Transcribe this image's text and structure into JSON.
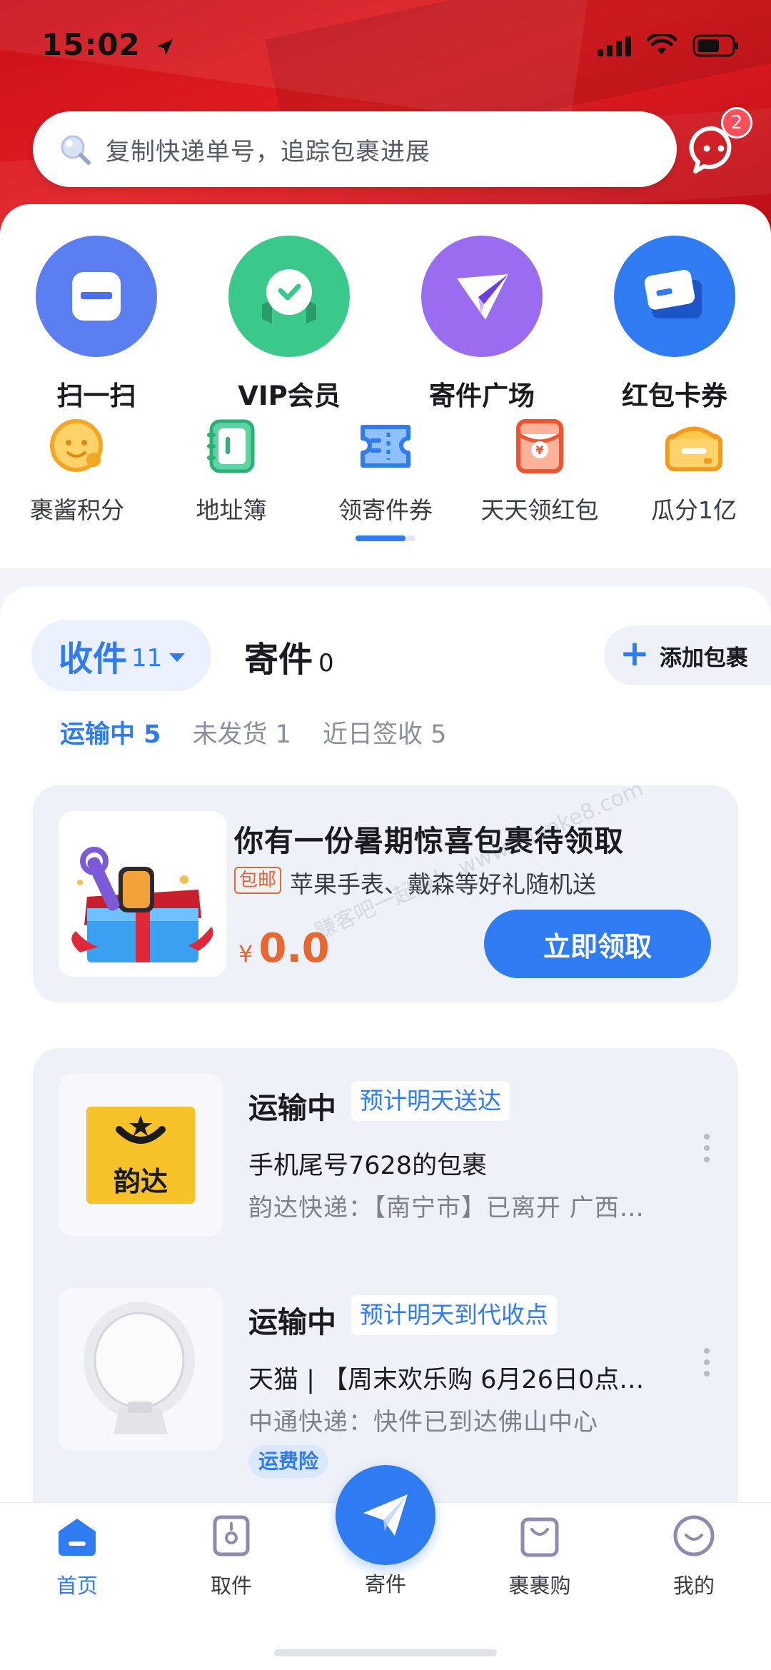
{
  "status_bar": {
    "time": "15:02"
  },
  "search": {
    "placeholder": "复制快递单号，追踪包裹进展",
    "message_badge": "2"
  },
  "main_grid": [
    {
      "label": "扫一扫",
      "icon": "scan-icon",
      "color": "#5b7ff0"
    },
    {
      "label": "VIP会员",
      "icon": "vip-icon",
      "color": "#3bc98b"
    },
    {
      "label": "寄件广场",
      "icon": "send-square-icon",
      "color": "#9a6cf0"
    },
    {
      "label": "红包卡券",
      "icon": "coupon-wallet-icon",
      "color": "#2f7bf1"
    }
  ],
  "sub_grid": [
    {
      "label": "裹酱积分",
      "icon": "points-icon"
    },
    {
      "label": "地址簿",
      "icon": "address-book-icon"
    },
    {
      "label": "领寄件券",
      "icon": "ticket-icon"
    },
    {
      "label": "天天领红包",
      "icon": "red-envelope-icon"
    },
    {
      "label": "瓜分1亿",
      "icon": "treasure-box-icon"
    }
  ],
  "parcel_tabs": {
    "receive_label": "收件",
    "receive_count": "11",
    "send_label": "寄件",
    "send_count": "0",
    "add_label": "添加包裹"
  },
  "status_tabs": [
    {
      "label": "运输中 5",
      "active": true
    },
    {
      "label": "未发货 1",
      "active": false
    },
    {
      "label": "近日签收 5",
      "active": false
    }
  ],
  "promo": {
    "title": "你有一份暑期惊喜包裹待领取",
    "tag": "包邮",
    "subtitle": "苹果手表、戴森等好礼随机送",
    "currency": "¥",
    "price": "0.0",
    "button": "立即领取"
  },
  "watermark": "赚客吧一起赚！ www.zuanke8.com",
  "packages": [
    {
      "state": "运输中",
      "eta": "预计明天送达",
      "name": "手机尾号7628的包裹",
      "detail": "韵达快递：【南宁市】已离开 广西…",
      "carrier_logo": "韵达",
      "chip": ""
    },
    {
      "state": "运输中",
      "eta": "预计明天到代收点",
      "name": "天猫 | 【周末欢乐购 6月26日0点…",
      "detail": "中通快递：快件已到达佛山中心",
      "carrier_logo": "",
      "chip": "运费险"
    }
  ],
  "tabbar": [
    {
      "label": "首页",
      "icon": "home-icon",
      "active": true
    },
    {
      "label": "取件",
      "icon": "pickup-icon",
      "active": false
    },
    {
      "label": "寄件",
      "icon": "paper-plane-icon",
      "active": false
    },
    {
      "label": "裹裹购",
      "icon": "shopping-bag-icon",
      "active": false
    },
    {
      "label": "我的",
      "icon": "profile-icon",
      "active": false
    }
  ],
  "colors": {
    "accent": "#2f7bf1",
    "hero_red": "#e31d22",
    "price_orange": "#e8662f"
  }
}
